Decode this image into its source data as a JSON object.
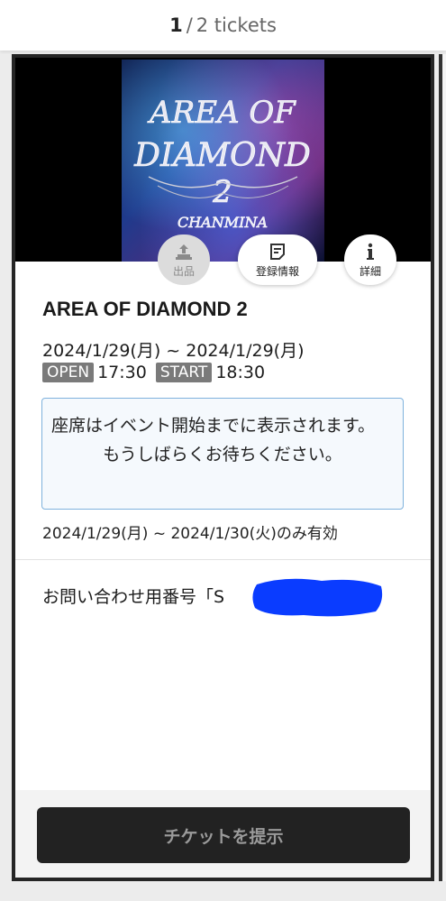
{
  "header": {
    "current": "1",
    "separator": "/",
    "rest": "2 tickets"
  },
  "ticket": {
    "title": "AREA OF DIAMOND 2",
    "date_range": "2024/1/29(月) ~ 2024/1/29(月)",
    "open_label": "OPEN",
    "open_time": "17:30",
    "start_label": "START",
    "start_time": "18:30",
    "seat_notice_line1": "座席はイベント開始までに表示されます。",
    "seat_notice_line2": "もうしばらくお待ちください。",
    "validity": "2024/1/29(月) ~ 2024/1/30(火)のみ有効",
    "inquiry_label": "お問い合わせ用番号「S"
  },
  "actions": {
    "list_label": "出品",
    "registration_label": "登録情報",
    "details_label": "詳細"
  },
  "banner": {
    "artwork_text_line1": "AREA OF",
    "artwork_text_line2": "DIAMOND",
    "artwork_text_line3": "2",
    "artwork_text_line4": "CHANMINA"
  },
  "present_button_label": "チケットを提示",
  "icons": {
    "list": "upload-tray-icon",
    "registration": "document-lines-icon",
    "details": "info-icon"
  },
  "colors": {
    "card_border": "#252525",
    "button_bg": "#222222",
    "button_text": "#9a9a9a",
    "notice_border": "#7fb2dd",
    "tag_bg": "#7a7a7a",
    "redaction": "#0a3cff"
  }
}
